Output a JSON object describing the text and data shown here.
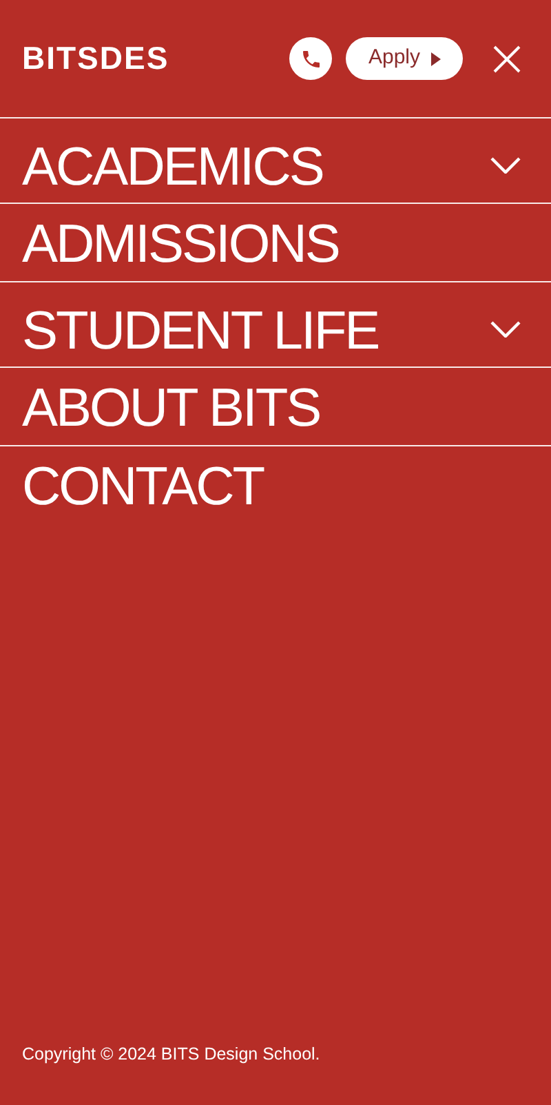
{
  "header": {
    "logo": "BITSDES",
    "apply_button": "Apply"
  },
  "menu": [
    {
      "label": "ACADEMICS",
      "kind": "dropdown"
    },
    {
      "label": "ADMISSIONS",
      "kind": "link"
    },
    {
      "label": "STUDENT LIFE",
      "kind": "dropdown"
    },
    {
      "label": "ABOUT BITS",
      "kind": "link"
    },
    {
      "label": "CONTACT",
      "kind": "link"
    }
  ],
  "footer": {
    "copyright": "Copyright © 2024 BITS Design School."
  }
}
